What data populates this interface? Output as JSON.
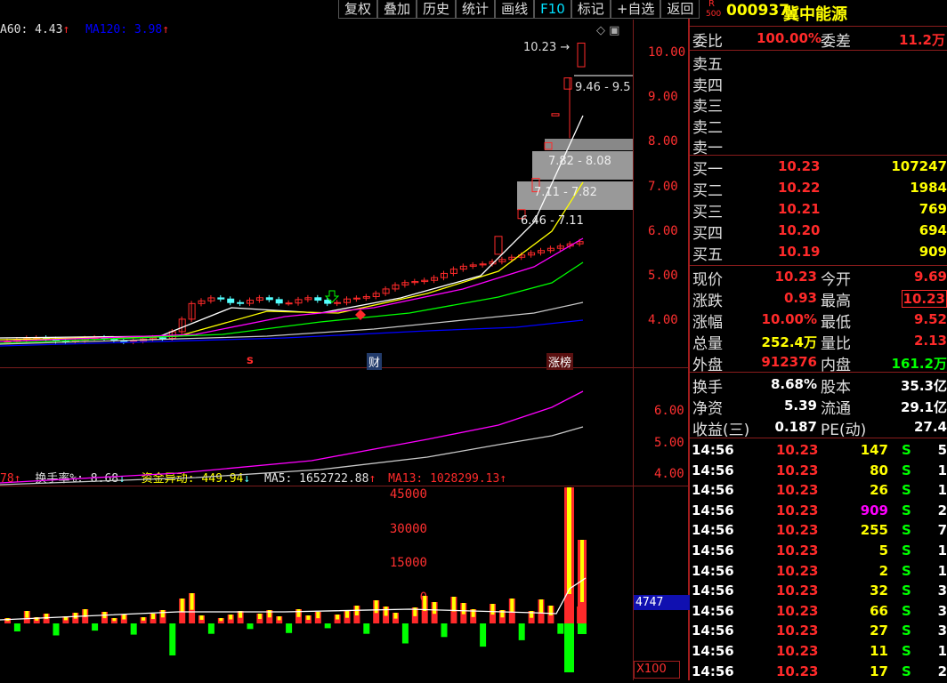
{
  "toolbar": [
    "复权",
    "叠加",
    "历史",
    "统计",
    "画线",
    "F10",
    "标记",
    "+自选",
    "返回"
  ],
  "main_legend": {
    "ma60": "A60: 4.43",
    "ma120": "MA120: 3.98"
  },
  "price_axis": [
    "10.00",
    "9.00",
    "8.00",
    "7.00",
    "6.00",
    "5.00",
    "4.00"
  ],
  "annotations": {
    "high": "10.23",
    "zone1": "9.46 - 9.5",
    "zone2": "7.82 - 8.08",
    "zone3": "7.11 - 7.82",
    "zone4": "6.46 - 7.11"
  },
  "event_markers": {
    "s": "s",
    "cai": "财",
    "zhangbang": "涨榜"
  },
  "mid_axis": [
    "6.00",
    "5.00",
    "4.00"
  ],
  "vol_legend": {
    "prefix": "78",
    "turnover": "换手率%: 8.68",
    "fund": "资金异动: 449.94",
    "ma5": "MA5: 1652722.88",
    "ma13": "MA13: 1028299.13"
  },
  "vol_axis": [
    "45000",
    "30000",
    "15000",
    "0"
  ],
  "vol_cursor": "4747",
  "vol_unit": "X100",
  "stock": {
    "r_badge": "R",
    "r_sub": "500",
    "code": "000937",
    "name": "冀中能源"
  },
  "weibi": {
    "label1": "委比",
    "value1": "100.00%",
    "label2": "委差",
    "value2": "11.2万"
  },
  "sell": [
    {
      "label": "卖五"
    },
    {
      "label": "卖四"
    },
    {
      "label": "卖三"
    },
    {
      "label": "卖二"
    },
    {
      "label": "卖一"
    }
  ],
  "buy": [
    {
      "label": "买一",
      "price": "10.23",
      "vol": "107247"
    },
    {
      "label": "买二",
      "price": "10.22",
      "vol": "1984"
    },
    {
      "label": "买三",
      "price": "10.21",
      "vol": "769"
    },
    {
      "label": "买四",
      "price": "10.20",
      "vol": "694"
    },
    {
      "label": "买五",
      "price": "10.19",
      "vol": "909"
    }
  ],
  "quote": [
    {
      "l1": "现价",
      "v1": "10.23",
      "l2": "今开",
      "v2": "9.69"
    },
    {
      "l1": "涨跌",
      "v1": "0.93",
      "l2": "最高",
      "v2": "10.23"
    },
    {
      "l1": "涨幅",
      "v1": "10.00%",
      "l2": "最低",
      "v2": "9.52"
    },
    {
      "l1": "总量",
      "v1": "252.4万",
      "l2": "量比",
      "v2": "2.13"
    },
    {
      "l1": "外盘",
      "v1": "912376",
      "l2": "内盘",
      "v2": "161.2万"
    }
  ],
  "finance": [
    {
      "l1": "换手",
      "v1": "8.68%",
      "l2": "股本",
      "v2": "35.3亿"
    },
    {
      "l1": "净资",
      "v1": "5.39",
      "l2": "流通",
      "v2": "29.1亿"
    },
    {
      "l1": "收益(三)",
      "v1": "0.187",
      "l2": "PE(动)",
      "v2": "27.4"
    }
  ],
  "ticks": [
    {
      "t": "14:56",
      "p": "10.23",
      "v": "147",
      "s": "S",
      "n": "5"
    },
    {
      "t": "14:56",
      "p": "10.23",
      "v": "80",
      "s": "S",
      "n": "1"
    },
    {
      "t": "14:56",
      "p": "10.23",
      "v": "26",
      "s": "S",
      "n": "1"
    },
    {
      "t": "14:56",
      "p": "10.23",
      "v": "909",
      "s": "S",
      "n": "2"
    },
    {
      "t": "14:56",
      "p": "10.23",
      "v": "255",
      "s": "S",
      "n": "7"
    },
    {
      "t": "14:56",
      "p": "10.23",
      "v": "5",
      "s": "S",
      "n": "1"
    },
    {
      "t": "14:56",
      "p": "10.23",
      "v": "2",
      "s": "S",
      "n": "1"
    },
    {
      "t": "14:56",
      "p": "10.23",
      "v": "32",
      "s": "S",
      "n": "3"
    },
    {
      "t": "14:56",
      "p": "10.23",
      "v": "66",
      "s": "S",
      "n": "3"
    },
    {
      "t": "14:56",
      "p": "10.23",
      "v": "27",
      "s": "S",
      "n": "3"
    },
    {
      "t": "14:56",
      "p": "10.23",
      "v": "11",
      "s": "S",
      "n": "1"
    },
    {
      "t": "14:56",
      "p": "10.23",
      "v": "17",
      "s": "S",
      "n": "2"
    }
  ],
  "colors": {
    "up": "#ff2a2a",
    "down": "#54ffff",
    "grid": "#7a1c1c",
    "ma_white": "#ffffff",
    "ma_yellow": "#ffff00",
    "ma_magenta": "#ff00ff",
    "ma_green": "#00ff00",
    "ma_gray": "#c8c8c8",
    "ma_blue": "#0000ff"
  }
}
